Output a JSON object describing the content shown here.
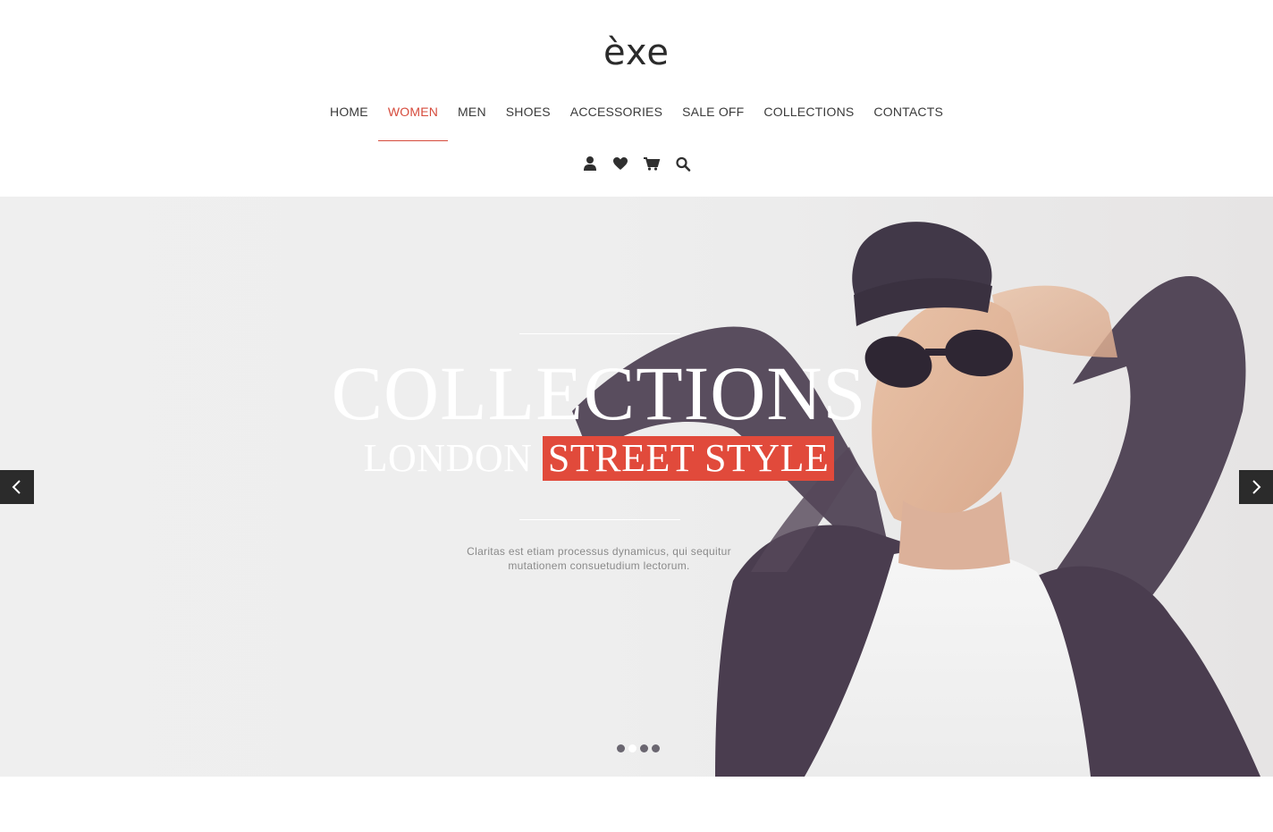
{
  "header": {
    "logo": "èxe",
    "nav": [
      {
        "label": "HOME",
        "active": false
      },
      {
        "label": "WOMEN",
        "active": true
      },
      {
        "label": "MEN",
        "active": false
      },
      {
        "label": "SHOES",
        "active": false
      },
      {
        "label": "ACCESSORIES",
        "active": false
      },
      {
        "label": "SALE OFF",
        "active": false
      },
      {
        "label": "COLLECTIONS",
        "active": false
      },
      {
        "label": "CONTACTS",
        "active": false
      }
    ],
    "icons": [
      "user-icon",
      "heart-icon",
      "cart-icon",
      "search-icon"
    ]
  },
  "hero": {
    "title": "COLLECTIONS",
    "subtitle_plain": "LONDON",
    "subtitle_highlight": "STREET STYLE",
    "text_line1": "Claritas est etiam processus dynamicus, qui sequitur",
    "text_line2": "mutationem consuetudium lectorum.",
    "prev_icon": "chevron-left-icon",
    "next_icon": "chevron-right-icon",
    "slides_total": 4,
    "active_slide": 2
  },
  "colors": {
    "accent": "#e14a3b",
    "nav_active": "#d64b3c",
    "dark": "#2b2b2b",
    "coat": "#4a3d4f"
  }
}
